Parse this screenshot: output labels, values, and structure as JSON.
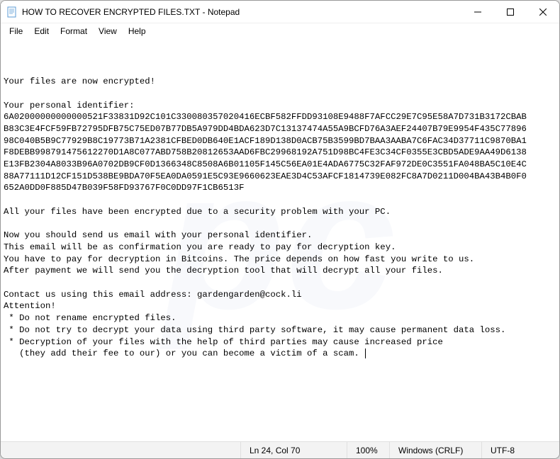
{
  "window": {
    "title": "HOW TO RECOVER ENCRYPTED FILES.TXT - Notepad"
  },
  "menubar": {
    "items": [
      "File",
      "Edit",
      "Format",
      "View",
      "Help"
    ]
  },
  "content": {
    "line01": "Your files are now encrypted!",
    "line02": "",
    "line03": "Your personal identifier:",
    "id1": "6A02000000000000521F33831D92C101C330080357020416ECBF582FFDD93108E9488F7AFCC29E7C95E58A7D731B3172CBAB",
    "id2": "B83C3E4FCF59FB72795DFB75C75ED07B77DB5A979DD4BDA623D7C13137474A55A9BCFD76A3AEF24407B79E9954F435C77896",
    "id3": "98C040B5B9C77929B8C19773B71A2381CFBED0DB640E1ACF189D138D0ACB75B3599BD7BAA3AABA7C6FAC34D37711C9870BA1",
    "id4": "F8DEBB998791475612270D1A8C077ABD758B20812653AAD6FBC29968192A751D98BC4FE3C34CF0355E3CBD5ADE9AA49D6138",
    "id5": "E13FB2304A8033B96A0702DB9CF0D1366348C8508A6B01105F145C56EA01E4ADA6775C32FAF972DE0C3551FA048BA5C10E4C",
    "id6": "88A77111D12CF151D538BE9BDA70F5EA0DA0591E5C93E9660623EAE3D4C53AFCF1814739E082FC8A7D0211D004BA43B4B0F0",
    "id7": "652A0DD0F885D47B039F58FD93767F0C0DD97F1CB6513F",
    "line11": "",
    "line12": "All your files have been encrypted due to a security problem with your PC.",
    "line13": "",
    "line14": "Now you should send us email with your personal identifier.",
    "line15": "This email will be as confirmation you are ready to pay for decryption key.",
    "line16": "You have to pay for decryption in Bitcoins. The price depends on how fast you write to us.",
    "line17": "After payment we will send you the decryption tool that will decrypt all your files.",
    "line18": "",
    "line19": "Contact us using this email address: gardengarden@cock.li",
    "line20": "Attention!",
    "line21": " * Do not rename encrypted files.",
    "line22": " * Do not try to decrypt your data using third party software, it may cause permanent data loss.",
    "line23": " * Decryption of your files with the help of third parties may cause increased price",
    "line24": "   (they add their fee to our) or you can become a victim of a scam. "
  },
  "statusbar": {
    "cursor": "Ln 24, Col 70",
    "zoom": "100%",
    "lineEnding": "Windows (CRLF)",
    "encoding": "UTF-8"
  }
}
